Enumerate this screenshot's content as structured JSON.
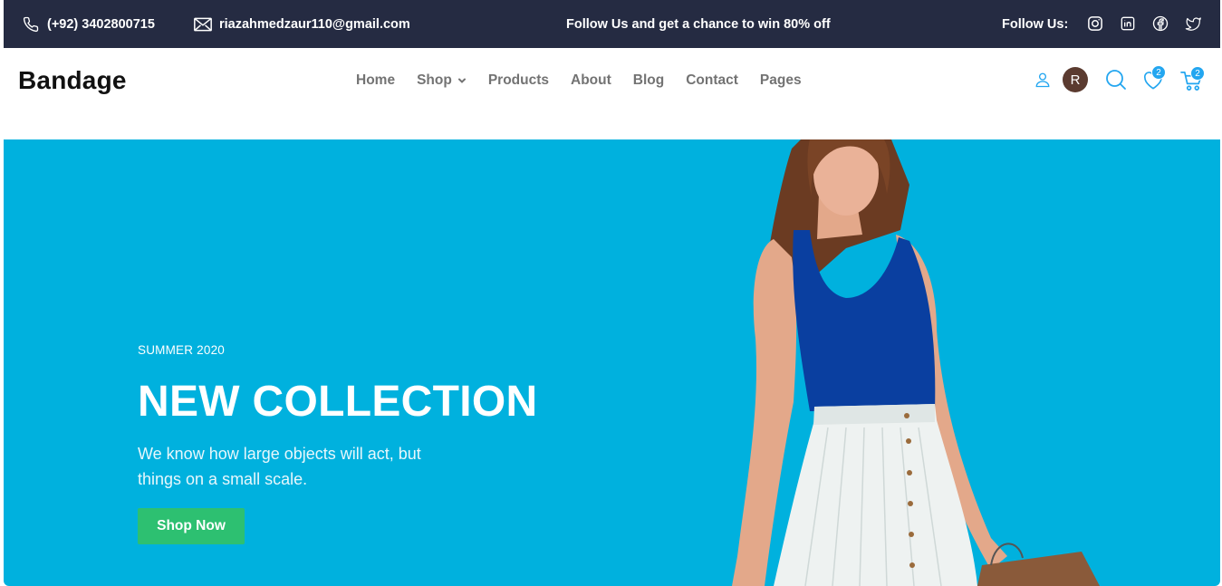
{
  "topbar": {
    "phone": "(+92) 3402800715",
    "email": "riazahmedzaur110@gmail.com",
    "promo": "Follow Us and get a chance to win 80% off",
    "follow_label": "Follow Us:",
    "icons": [
      "phone-icon",
      "mail-icon",
      "instagram-icon",
      "linkedin-icon",
      "facebook-icon",
      "twitter-icon"
    ]
  },
  "nav": {
    "brand": "Bandage",
    "menu": [
      "Home",
      "Shop",
      "Products",
      "About",
      "Blog",
      "Contact",
      "Pages"
    ],
    "avatar_initial": "R",
    "wishlist_count": "2",
    "cart_count": "2",
    "icons": [
      "user-icon",
      "search-icon",
      "heart-icon",
      "cart-icon",
      "chevron-down-icon"
    ]
  },
  "hero": {
    "subtitle": "SUMMER 2020",
    "title": "NEW COLLECTION",
    "description": "We know how large objects will act, but things on a small scale.",
    "button": "Shop Now"
  },
  "colors": {
    "topbar_bg": "#252b42",
    "hero_bg": "#00b1de",
    "primary": "#23a6f0",
    "button": "#2dc071",
    "menu_text": "#737373"
  }
}
